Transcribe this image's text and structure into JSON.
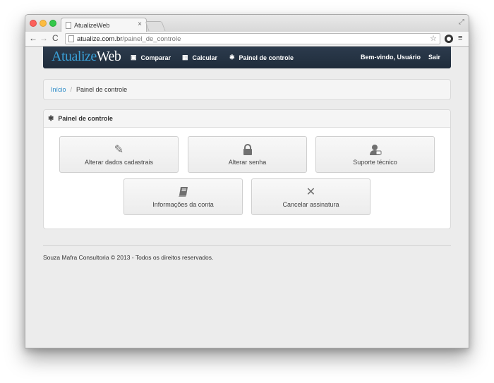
{
  "browser": {
    "tab_title": "AtualizeWeb",
    "tab_close": "×",
    "url_host": "atualize.com.br",
    "url_path": "/painel_de_controle",
    "back": "←",
    "forward": "→",
    "reload": "C",
    "star": "☆",
    "menu": "≡",
    "fullscreen": "⤢"
  },
  "navbar": {
    "brand_a": "A",
    "brand_rest_1": "tualize",
    "brand_rest_2": "Web",
    "items": [
      {
        "label": "Comparar",
        "icon": "▣"
      },
      {
        "label": "Calcular",
        "icon": "▦"
      },
      {
        "label": "Painel de controle",
        "icon": "✱"
      }
    ],
    "welcome": "Bem-vindo, Usuário",
    "logout": "Sair"
  },
  "breadcrumb": {
    "home": "Início",
    "separator": "/",
    "current": "Painel de controle"
  },
  "panel": {
    "title": "Painel de controle",
    "icon": "✱",
    "tiles": [
      {
        "label": "Alterar dados cadastrais",
        "icon": "✎"
      },
      {
        "label": "Alterar senha",
        "icon": "🔒"
      },
      {
        "label": "Suporte técnico",
        "icon": "☻"
      },
      {
        "label": "Informações da conta",
        "icon": "▤"
      },
      {
        "label": "Cancelar assinatura",
        "icon": "✕"
      }
    ]
  },
  "footer": {
    "text": "Souza Mafra Consultoria © 2013 - Todos os direitos reservados."
  },
  "colors": {
    "navbar": "#22303f",
    "link": "#2a8ac8"
  }
}
